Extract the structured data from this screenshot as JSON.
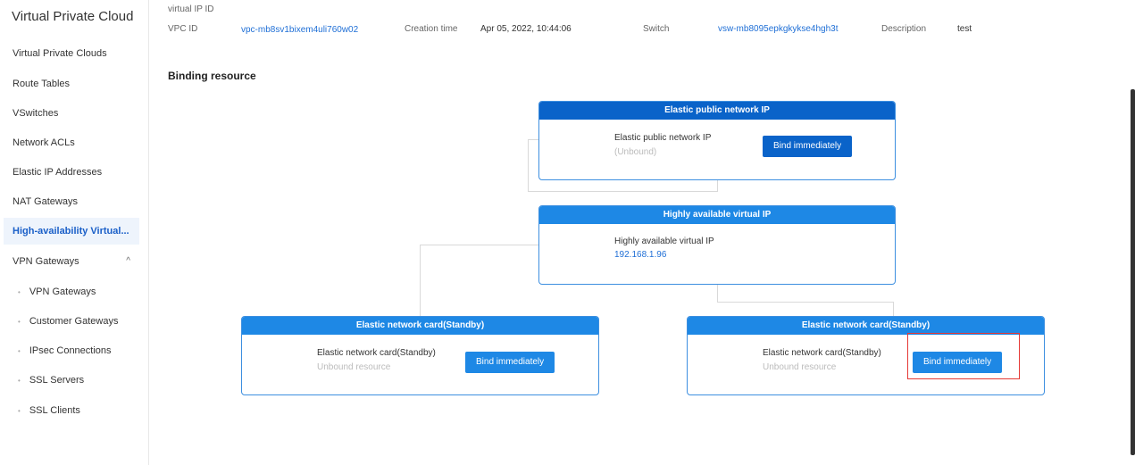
{
  "sidebar": {
    "title": "Virtual Private Cloud",
    "items": [
      {
        "label": "Virtual Private Clouds"
      },
      {
        "label": "Route Tables"
      },
      {
        "label": "VSwitches"
      },
      {
        "label": "Network ACLs"
      },
      {
        "label": "Elastic IP Addresses"
      },
      {
        "label": "NAT Gateways"
      },
      {
        "label": "High-availability Virtual..."
      },
      {
        "label": "VPN Gateways",
        "chevron": "^"
      },
      {
        "label": "VPN Gateways",
        "bullet": "•"
      },
      {
        "label": "Customer Gateways",
        "bullet": "•"
      },
      {
        "label": "IPsec Connections",
        "bullet": "•"
      },
      {
        "label": "SSL Servers",
        "bullet": "•"
      },
      {
        "label": "SSL Clients",
        "bullet": "•"
      }
    ]
  },
  "info": {
    "virtual_ip_label": "virtual IP ID",
    "vpc_id_label": "VPC ID",
    "vpc_id_value": "vpc-mb8sv1bixem4uli760w02",
    "creation_label": "Creation time",
    "creation_value": "Apr 05, 2022, 10:44:06",
    "switch_label": "Switch",
    "switch_value": "vsw-mb8095epkgkykse4hgh3t",
    "description_label": "Description",
    "description_value": "test"
  },
  "section": {
    "title": "Binding resource"
  },
  "cards": {
    "eip": {
      "header": "Elastic public network IP",
      "label": "Elastic public network IP",
      "sub": "(Unbound)",
      "button": "Bind immediately"
    },
    "havip": {
      "header": "Highly available virtual IP",
      "label": "Highly available virtual IP",
      "sub": "192.168.1.96"
    },
    "eni_left": {
      "header": "Elastic network card(Standby)",
      "label": "Elastic network card(Standby)",
      "sub": "Unbound resource",
      "button": "Bind immediately"
    },
    "eni_right": {
      "header": "Elastic network card(Standby)",
      "label": "Elastic network card(Standby)",
      "sub": "Unbound resource",
      "button": "Bind immediately"
    }
  },
  "colors": {
    "accent": "#1e88e5",
    "accent_dark": "#0a63c9",
    "active_bg": "#eef4fc",
    "highlight": "#e53935"
  }
}
